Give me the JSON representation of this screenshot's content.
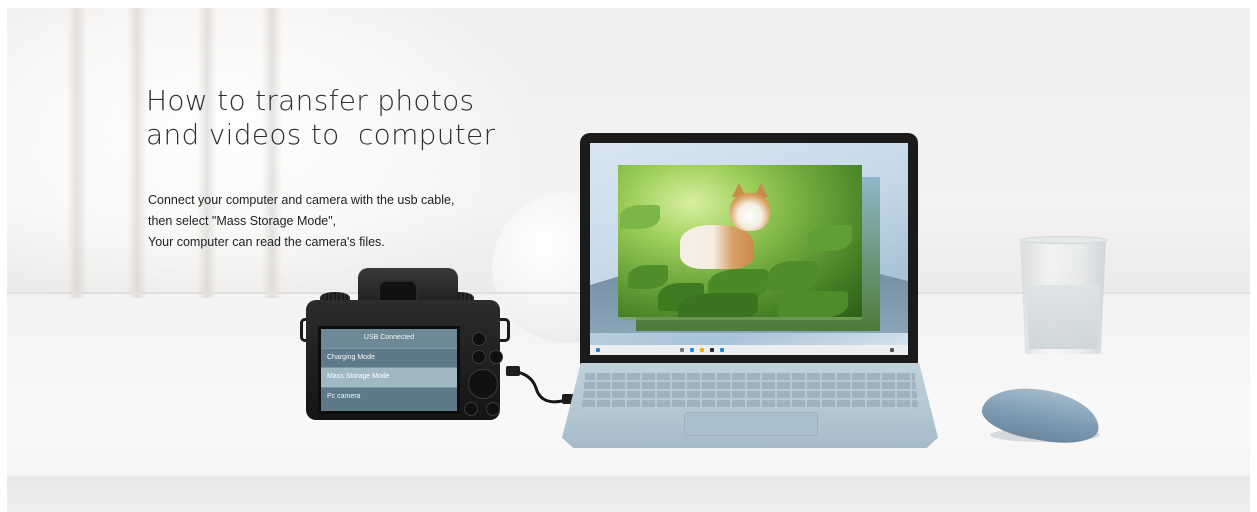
{
  "headline": {
    "line1": "How to transfer photos",
    "line2": "and videos to  computer"
  },
  "description": [
    "Connect your computer and camera with the usb cable,",
    "then select \"Mass Storage Mode\",",
    "Your computer can read the camera's files."
  ],
  "camera_menu": {
    "header": "USB Connected",
    "options": [
      "Charging Mode",
      "Mass Storage Mode",
      "Pc camera"
    ],
    "selected": "Mass Storage Mode"
  },
  "colors": {
    "headline": "#2e2e2e",
    "body_text": "#222222",
    "menu_bg": "#5e7a8a",
    "menu_selected": "#9fb8c2",
    "laptop": "#b3c6d2",
    "mouse": "#7f9cb2"
  }
}
